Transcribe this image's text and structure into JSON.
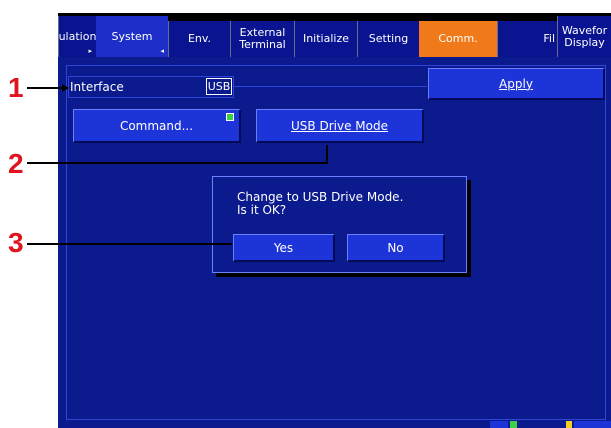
{
  "tabs": [
    {
      "label": "ulation",
      "tick": "▸"
    },
    {
      "label": "System",
      "tick": "◂"
    },
    {
      "label": "Env.",
      "tick": ""
    },
    {
      "label": "External\nTerminal",
      "tick": ""
    },
    {
      "label": "Initialize",
      "tick": ""
    },
    {
      "label": "Setting",
      "tick": ""
    },
    {
      "label": "Comm.",
      "tick": ""
    },
    {
      "label": "Fil",
      "tick": ""
    },
    {
      "label": "Wavefor\nDisplay",
      "tick": ""
    }
  ],
  "interface": {
    "label": "Interface",
    "value": "USB"
  },
  "buttons": {
    "apply": "Apply",
    "command": "Command...",
    "usb_drive_mode": "USB Drive Mode"
  },
  "dialog": {
    "message": "Change to USB Drive Mode.\nIs it OK?",
    "yes": "Yes",
    "no": "No"
  },
  "callouts": [
    "1",
    "2",
    "3"
  ],
  "colors": {
    "screen_bg": "#0b1a8c",
    "active_tab": "#f07a1a",
    "button": "#1d35d8",
    "callout": "#e0141e",
    "led": "#3cd04a"
  }
}
